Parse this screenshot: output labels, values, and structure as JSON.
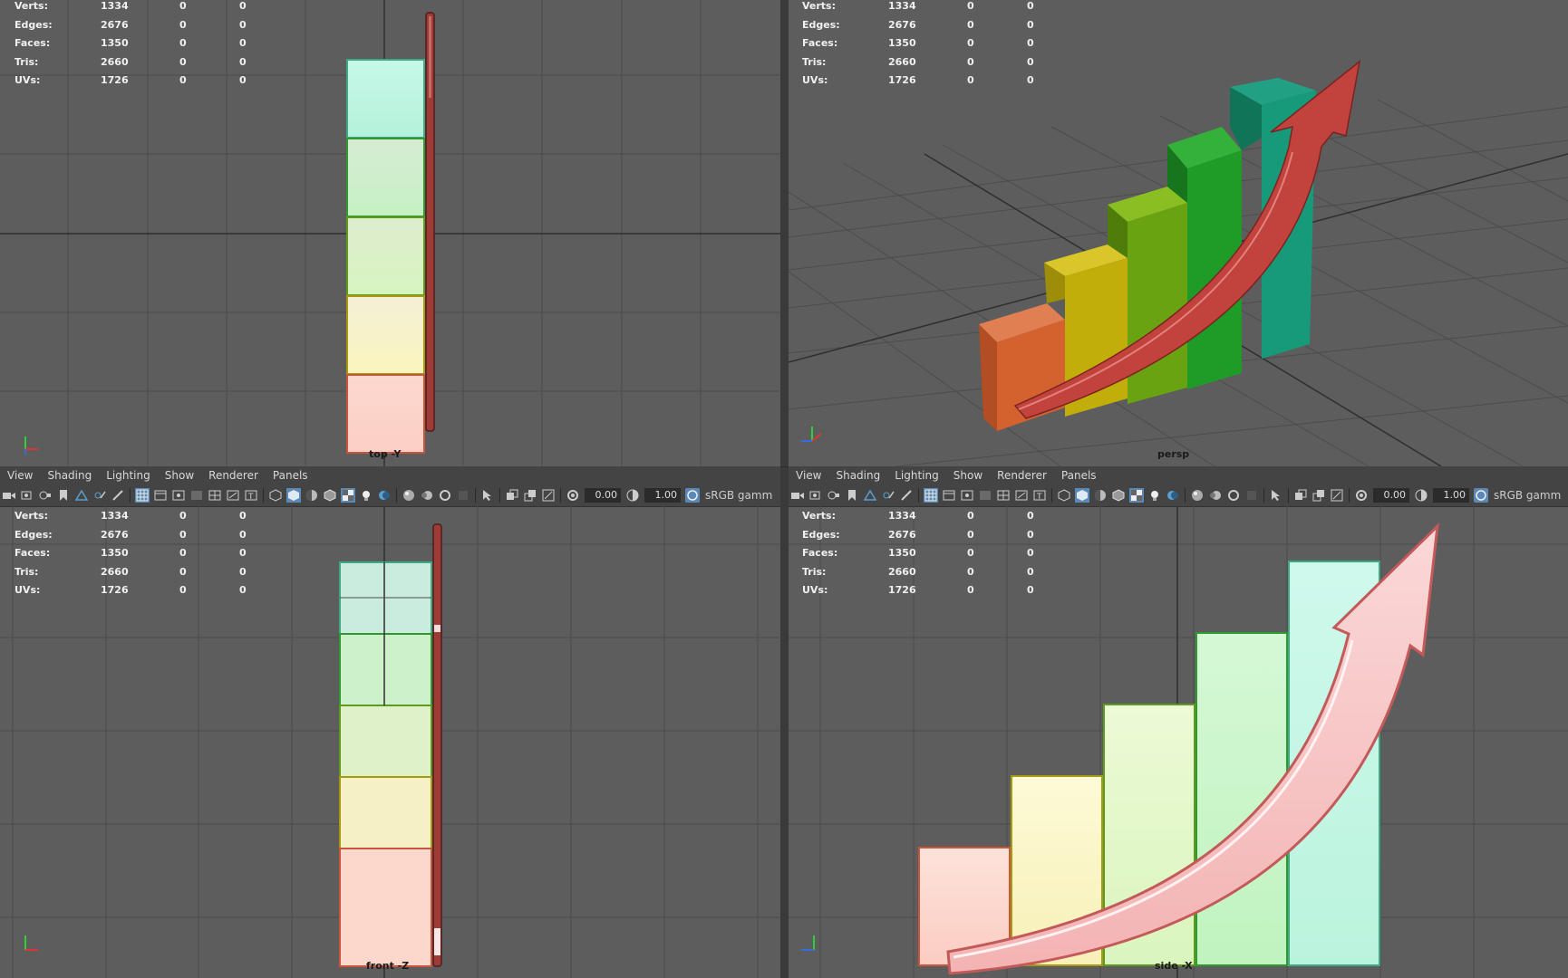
{
  "menu": [
    "View",
    "Shading",
    "Lighting",
    "Show",
    "Renderer",
    "Panels"
  ],
  "toolbar": {
    "exposure": "0.00",
    "gamma": "1.00",
    "colorspace": "sRGB gamm"
  },
  "hud": [
    {
      "label": "Verts:",
      "v1": "1334",
      "v2": "0",
      "v3": "0"
    },
    {
      "label": "Edges:",
      "v1": "2676",
      "v2": "0",
      "v3": "0"
    },
    {
      "label": "Faces:",
      "v1": "1350",
      "v2": "0",
      "v3": "0"
    },
    {
      "label": "Tris:",
      "v1": "2660",
      "v2": "0",
      "v3": "0"
    },
    {
      "label": "UVs:",
      "v1": "1726",
      "v2": "0",
      "v3": "0"
    }
  ],
  "cameras": {
    "top": "top -Y",
    "persp": "persp",
    "front": "front -Z",
    "side": "side -X"
  },
  "colors": {
    "viewport_bg": "#5d5d5d",
    "grid": "#4f4f4f",
    "grid_axis": "#2e2e2e",
    "arrow_red": "#c0433e",
    "arrow_pink": "#f7c9c9",
    "bars_wire": [
      "#fbd3c9",
      "#fbf5c2",
      "#e3f7c5",
      "#c9f5c9",
      "#c6f8e8"
    ],
    "bars_persp": [
      "#d66a3f",
      "#c7b410",
      "#76ad16",
      "#27a831",
      "#1bab86"
    ]
  }
}
